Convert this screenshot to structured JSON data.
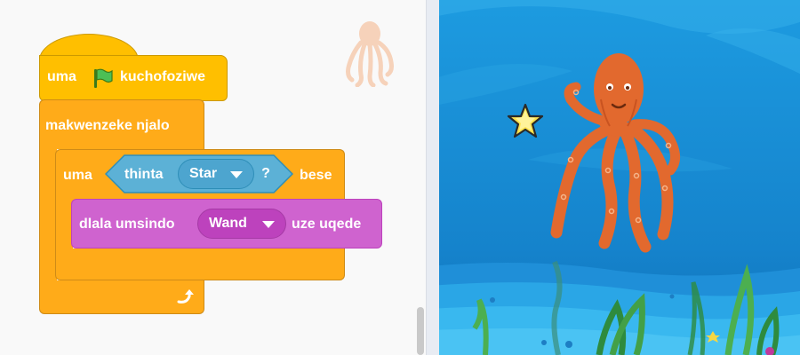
{
  "blocks": {
    "hat": {
      "before_flag": "uma",
      "after_flag": "kuchofoziwe"
    },
    "forever": {
      "label": "makwenzeke njalo"
    },
    "if_block": {
      "prefix": "uma",
      "suffix": "bese",
      "condition": {
        "label": "thinta",
        "target": "Star",
        "question_mark": "?"
      }
    },
    "sound_block": {
      "prefix": "dlala umsindo",
      "sound": "Wand",
      "suffix": "uze uqede"
    }
  },
  "icons": {
    "flag": "green-flag-icon",
    "loop_arrow": "loop-arrow-icon",
    "dropdown": "chevron-down-icon"
  },
  "colors": {
    "events": "#ffbf00",
    "control": "#ffab19",
    "sensing": "#5cb1d6",
    "sound": "#cf63cf",
    "stage_water": "#1d8fd6",
    "octopus": "#e2692e"
  }
}
